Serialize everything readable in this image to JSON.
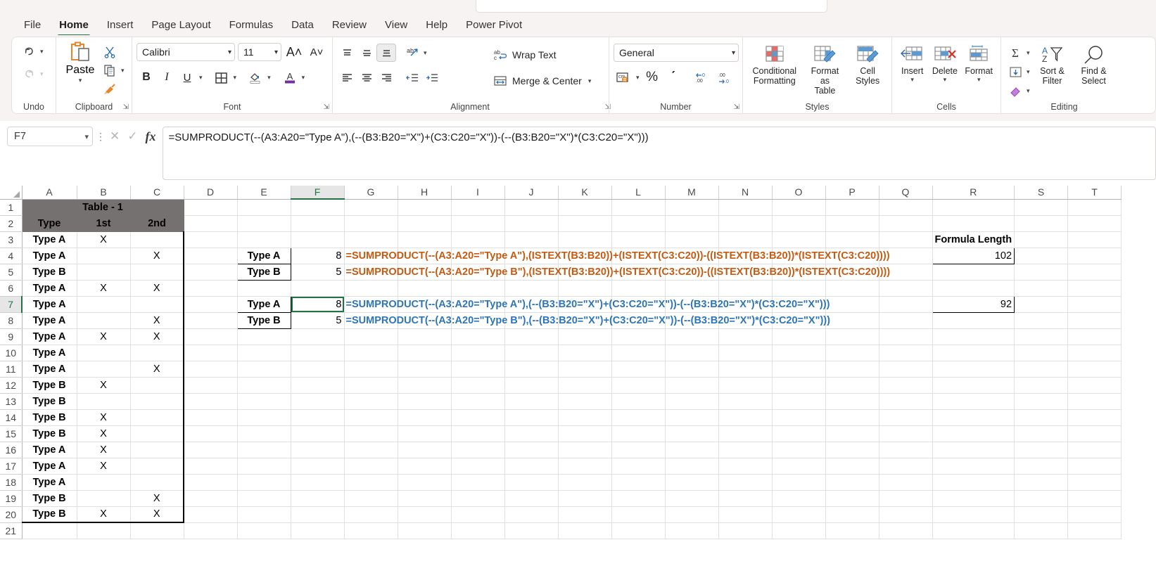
{
  "app": {
    "ribbon_tabs": [
      "File",
      "Home",
      "Insert",
      "Page Layout",
      "Formulas",
      "Data",
      "Review",
      "View",
      "Help",
      "Power Pivot"
    ],
    "active_tab": "Home"
  },
  "ribbon": {
    "groups": {
      "undo": {
        "label": "Undo",
        "undo_icon": "undo-arrow-icon",
        "redo_icon": "redo-arrow-icon"
      },
      "clipboard": {
        "label": "Clipboard",
        "paste_label": "Paste",
        "cut_icon": "scissors-icon",
        "copy_icon": "copy-icon",
        "format_painter_icon": "format-painter-icon"
      },
      "font": {
        "label": "Font",
        "font_name": "Calibri",
        "font_size": "11",
        "grow_font": "A˄",
        "shrink_font": "A˅",
        "bold": "B",
        "italic": "I",
        "underline": "U",
        "borders_icon": "borders-icon",
        "fill_color_icon": "fill-color-icon",
        "font_color_icon": "font-color-icon"
      },
      "alignment": {
        "label": "Alignment",
        "wrap_text": "Wrap Text",
        "merge_center": "Merge & Center",
        "orientation_icon": "text-orientation-icon",
        "top_align_icon": "align-top-icon",
        "middle_align_icon": "align-middle-icon",
        "bottom_align_icon": "align-bottom-icon",
        "left_align_icon": "align-left-icon",
        "center_align_icon": "align-center-icon",
        "right_align_icon": "align-right-icon",
        "decrease_indent_icon": "decrease-indent-icon",
        "increase_indent_icon": "increase-indent-icon"
      },
      "number": {
        "label": "Number",
        "format": "General",
        "accounting_icon": "accounting-format-icon",
        "percent": "%",
        "comma": "ʹ",
        "decrease_decimal": "decrease-decimal-icon",
        "increase_decimal": "increase-decimal-icon"
      },
      "styles": {
        "label": "Styles",
        "conditional_formatting": "Conditional\nFormatting",
        "format_as_table": "Format as\nTable",
        "cell_styles": "Cell\nStyles"
      },
      "cells": {
        "label": "Cells",
        "insert": "Insert",
        "delete": "Delete",
        "format": "Format"
      },
      "editing": {
        "label": "Editing",
        "autosum_icon": "sigma-autosum-icon",
        "fill_icon": "fill-down-icon",
        "clear_icon": "clear-eraser-icon",
        "sort_filter": "Sort &\nFilter",
        "find_select": "Find &\nSelect"
      }
    }
  },
  "formula_bar": {
    "name_box": "F7",
    "cancel_icon": "cancel-x-icon",
    "enter_icon": "enter-check-icon",
    "function_icon": "fx-insert-function-icon",
    "formula": "=SUMPRODUCT(--(A3:A20=\"Type A\"),(--(B3:B20=\"X\")+(C3:C20=\"X\"))-(--(B3:B20=\"X\")*(C3:C20=\"X\")))"
  },
  "grid": {
    "column_headers": [
      "A",
      "B",
      "C",
      "D",
      "E",
      "F",
      "G",
      "H",
      "I",
      "J",
      "K",
      "L",
      "M",
      "N",
      "O",
      "P",
      "Q",
      "R",
      "S",
      "T"
    ],
    "row_headers": [
      "1",
      "2",
      "3",
      "4",
      "5",
      "6",
      "7",
      "8",
      "9",
      "10",
      "11",
      "12",
      "13",
      "14",
      "15",
      "16",
      "17",
      "18",
      "19",
      "20",
      "21"
    ],
    "selected_cell": "F7",
    "selected_column": "F",
    "selected_row": "7",
    "table1": {
      "title": "Table - 1",
      "headers": [
        "Type",
        "1st",
        "2nd"
      ],
      "rows": [
        {
          "type": "Type A",
          "first": "X",
          "second": ""
        },
        {
          "type": "Type A",
          "first": "",
          "second": "X"
        },
        {
          "type": "Type B",
          "first": "",
          "second": ""
        },
        {
          "type": "Type A",
          "first": "X",
          "second": "X"
        },
        {
          "type": "Type A",
          "first": "",
          "second": ""
        },
        {
          "type": "Type A",
          "first": "",
          "second": "X"
        },
        {
          "type": "Type A",
          "first": "X",
          "second": "X"
        },
        {
          "type": "Type A",
          "first": "",
          "second": ""
        },
        {
          "type": "Type A",
          "first": "",
          "second": "X"
        },
        {
          "type": "Type B",
          "first": "X",
          "second": ""
        },
        {
          "type": "Type B",
          "first": "",
          "second": ""
        },
        {
          "type": "Type B",
          "first": "X",
          "second": ""
        },
        {
          "type": "Type B",
          "first": "X",
          "second": ""
        },
        {
          "type": "Type A",
          "first": "X",
          "second": ""
        },
        {
          "type": "Type A",
          "first": "X",
          "second": ""
        },
        {
          "type": "Type A",
          "first": "",
          "second": ""
        },
        {
          "type": "Type B",
          "first": "",
          "second": "X"
        },
        {
          "type": "Type B",
          "first": "X",
          "second": "X"
        }
      ]
    },
    "results": {
      "block1": [
        {
          "label": "Type A",
          "value": "8",
          "formula": "=SUMPRODUCT(--(A3:A20=\"Type A\"),(ISTEXT(B3:B20))+(ISTEXT(C3:C20))-((ISTEXT(B3:B20))*(ISTEXT(C3:C20))))"
        },
        {
          "label": "Type B",
          "value": "5",
          "formula": "=SUMPRODUCT(--(A3:A20=\"Type B\"),(ISTEXT(B3:B20))+(ISTEXT(C3:C20))-((ISTEXT(B3:B20))*(ISTEXT(C3:C20))))"
        }
      ],
      "block2": [
        {
          "label": "Type A",
          "value": "8",
          "formula": "=SUMPRODUCT(--(A3:A20=\"Type A\"),(--(B3:B20=\"X\")+(C3:C20=\"X\"))-(--(B3:B20=\"X\")*(C3:C20=\"X\")))"
        },
        {
          "label": "Type B",
          "value": "5",
          "formula": "=SUMPRODUCT(--(A3:A20=\"Type B\"),(--(B3:B20=\"X\")+(C3:C20=\"X\"))-(--(B3:B20=\"X\")*(C3:C20=\"X\")))"
        }
      ],
      "formula_length_header": "Formula Length",
      "formula_lengths": [
        "102",
        "92"
      ]
    }
  },
  "colors": {
    "accent_green": "#217346",
    "table_header_bg": "#767171",
    "table_title_fg": "#ffff00",
    "type_a": "#ff0000",
    "type_b": "#4472c4",
    "formula_orange": "#c55a11",
    "formula_blue": "#2e75b6",
    "formula_length_purple": "#7030a0"
  }
}
